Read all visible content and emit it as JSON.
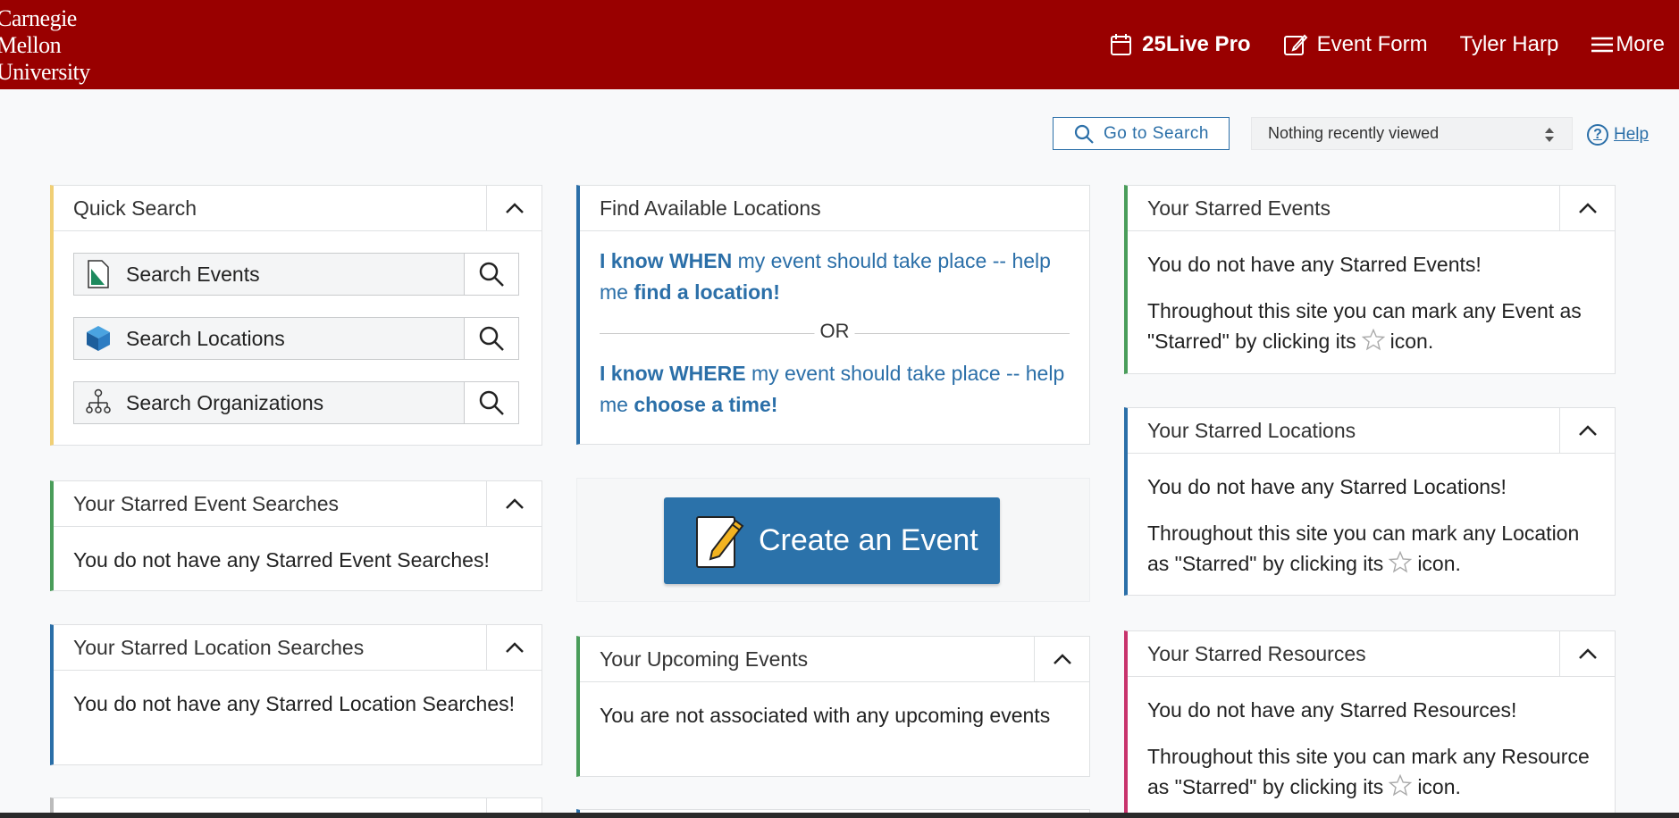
{
  "header": {
    "logo_lines": [
      "Carnegie",
      "Mellon",
      "University"
    ],
    "nav": {
      "live_pro": "25Live Pro",
      "event_form": "Event Form",
      "user": "Tyler Harp",
      "more": "More"
    }
  },
  "toolbar": {
    "go_search": "Go to Search",
    "recent": "Nothing recently viewed",
    "help": "Help"
  },
  "quick_search": {
    "title": "Quick Search",
    "rows": [
      {
        "label": "Search Events",
        "icon": "event-document-icon"
      },
      {
        "label": "Search Locations",
        "icon": "location-cube-icon"
      },
      {
        "label": "Search Organizations",
        "icon": "organization-tree-icon"
      }
    ]
  },
  "starred_event_searches": {
    "title": "Your Starred Event Searches",
    "text": "You do not have any Starred Event Searches!"
  },
  "starred_location_searches": {
    "title": "Your Starred Location Searches",
    "text": "You do not have any Starred Location Searches!"
  },
  "find_locations": {
    "title": "Find Available Locations",
    "when_1": "I know WHEN",
    "when_2": " my event should take place -- help me ",
    "when_3": "find a location!",
    "or": "OR",
    "where_1": "I know WHERE",
    "where_2": " my event should take place -- help me ",
    "where_3": "choose a time!"
  },
  "create_event": {
    "label": "Create an Event"
  },
  "upcoming": {
    "title": "Your Upcoming Events",
    "text": "You are not associated with any upcoming events"
  },
  "starred_events": {
    "title": "Your Starred Events",
    "text1": "You do not have any Starred Events!",
    "text2a": "Throughout this site you can mark any Event as \"Starred\" by clicking its",
    "text2b": "icon."
  },
  "starred_locations": {
    "title": "Your Starred Locations",
    "text1": "You do not have any Starred Locations!",
    "text2a": "Throughout this site you can mark any Location as \"Starred\" by clicking its",
    "text2b": "icon."
  },
  "starred_resources": {
    "title": "Your Starred Resources",
    "text1": "You do not have any Starred Resources!",
    "text2a": "Throughout this site you can mark any Resource as \"Starred\" by clicking its",
    "text2b": "icon."
  },
  "colors": {
    "brand": "#990000",
    "link": "#2b6fa8",
    "accent_yellow": "#f0cf75",
    "accent_green": "#4a9d5a",
    "accent_pink": "#c8336c"
  }
}
